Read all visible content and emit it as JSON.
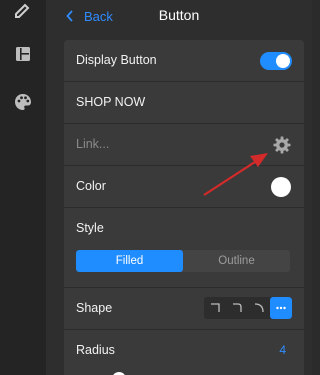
{
  "header": {
    "back_label": "Back",
    "title": "Button"
  },
  "rail": {
    "icons": [
      "pencil-icon",
      "layout-icon",
      "palette-icon"
    ]
  },
  "settings": {
    "display_button": {
      "label": "Display Button",
      "enabled": true
    },
    "button_text": "SHOP NOW",
    "link": {
      "placeholder": "Link...",
      "icon": "gear-icon"
    },
    "color": {
      "label": "Color",
      "value": "#ffffff"
    },
    "style": {
      "label": "Style",
      "options": [
        "Filled",
        "Outline"
      ],
      "selected": "Filled"
    },
    "shape": {
      "label": "Shape",
      "options": [
        "square-corner",
        "slight-round",
        "round",
        "more"
      ],
      "selected": "more"
    },
    "radius": {
      "label": "Radius",
      "value": "4"
    }
  },
  "colors": {
    "accent": "#1f8cff",
    "arrow": "#d32a2a"
  }
}
